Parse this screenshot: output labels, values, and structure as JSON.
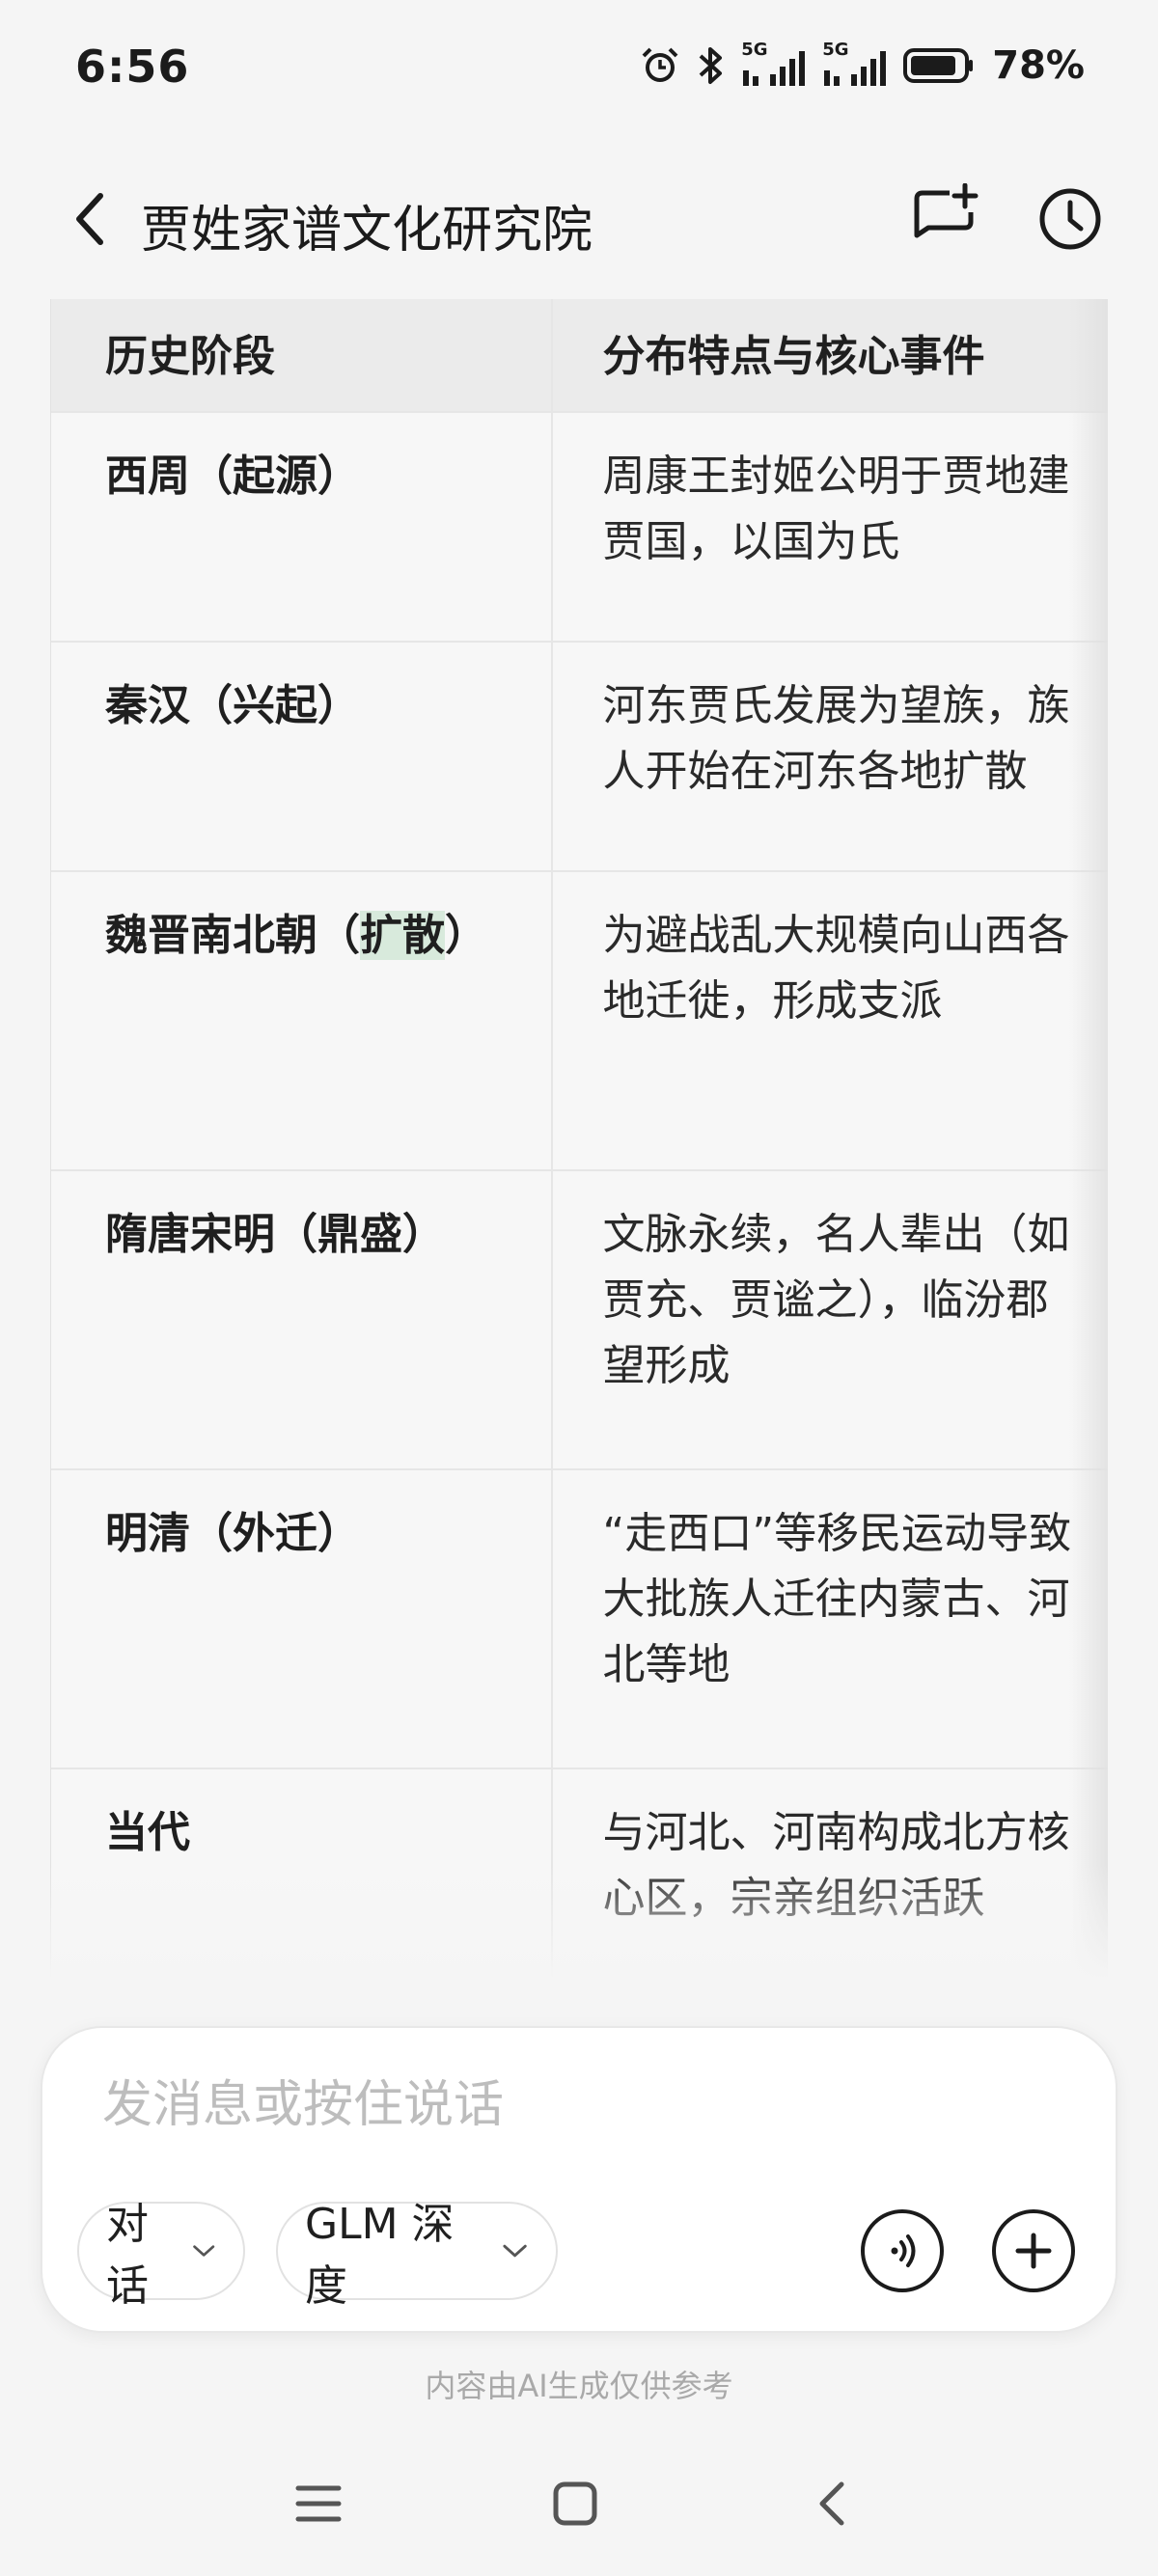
{
  "status_bar": {
    "time": "6:56",
    "battery": "78%",
    "icons": [
      "alarm-icon",
      "bluetooth-icon",
      "signal-5g-icon",
      "signal-5g-icon",
      "battery-icon"
    ],
    "signal_label_1": "5G",
    "signal_label_2": "5G"
  },
  "header": {
    "title": "贾姓家谱文化研究院",
    "icons": [
      "chevron-left-icon",
      "new-chat-icon",
      "history-clock-icon"
    ]
  },
  "table": {
    "headers": [
      "历史阶段",
      "分布特点与核心事件"
    ],
    "rows": [
      {
        "stage": "西周（起源）",
        "desc": [
          "周康王封姬公明于贾地建",
          "贾国，以国为氏"
        ]
      },
      {
        "stage": "秦汉（兴起）",
        "desc": [
          "河东贾氏发展为望族，族",
          "人开始在河东各地扩散"
        ]
      },
      {
        "stage_before": "魏晋南北朝（",
        "stage_highlight": "扩散",
        "stage_after": "）",
        "desc": [
          "为避战乱大规模向山西各",
          "地迁徙，形成支派"
        ]
      },
      {
        "stage": "隋唐宋明（鼎盛）",
        "desc": [
          "文脉永续，名人辈出（如",
          "贾充、贾谧之），临汾郡",
          "望形成"
        ]
      },
      {
        "stage": "明清（外迁）",
        "desc": [
          "“走西口”等移民运动导致",
          "大批族人迁往内蒙古、河",
          "北等地"
        ]
      },
      {
        "stage": "当代",
        "desc": [
          "与河北、河南构成北方核",
          "心区，宗亲组织活跃"
        ]
      }
    ]
  },
  "input": {
    "placeholder": "发消息或按住说话",
    "mode_label": "对话",
    "model_label": "GLM 深度",
    "icons": [
      "voice-icon",
      "plus-icon"
    ]
  },
  "disclaimer": "内容由AI生成仅供参考",
  "nav": {
    "icons": [
      "menu-icon",
      "home-icon",
      "back-icon"
    ]
  },
  "colors": {
    "background": "#f5f5f5",
    "table_header_bg": "#ebebeb",
    "highlight": "#d8eadc",
    "text": "#1f1f1f",
    "placeholder": "#bdbdbd"
  }
}
